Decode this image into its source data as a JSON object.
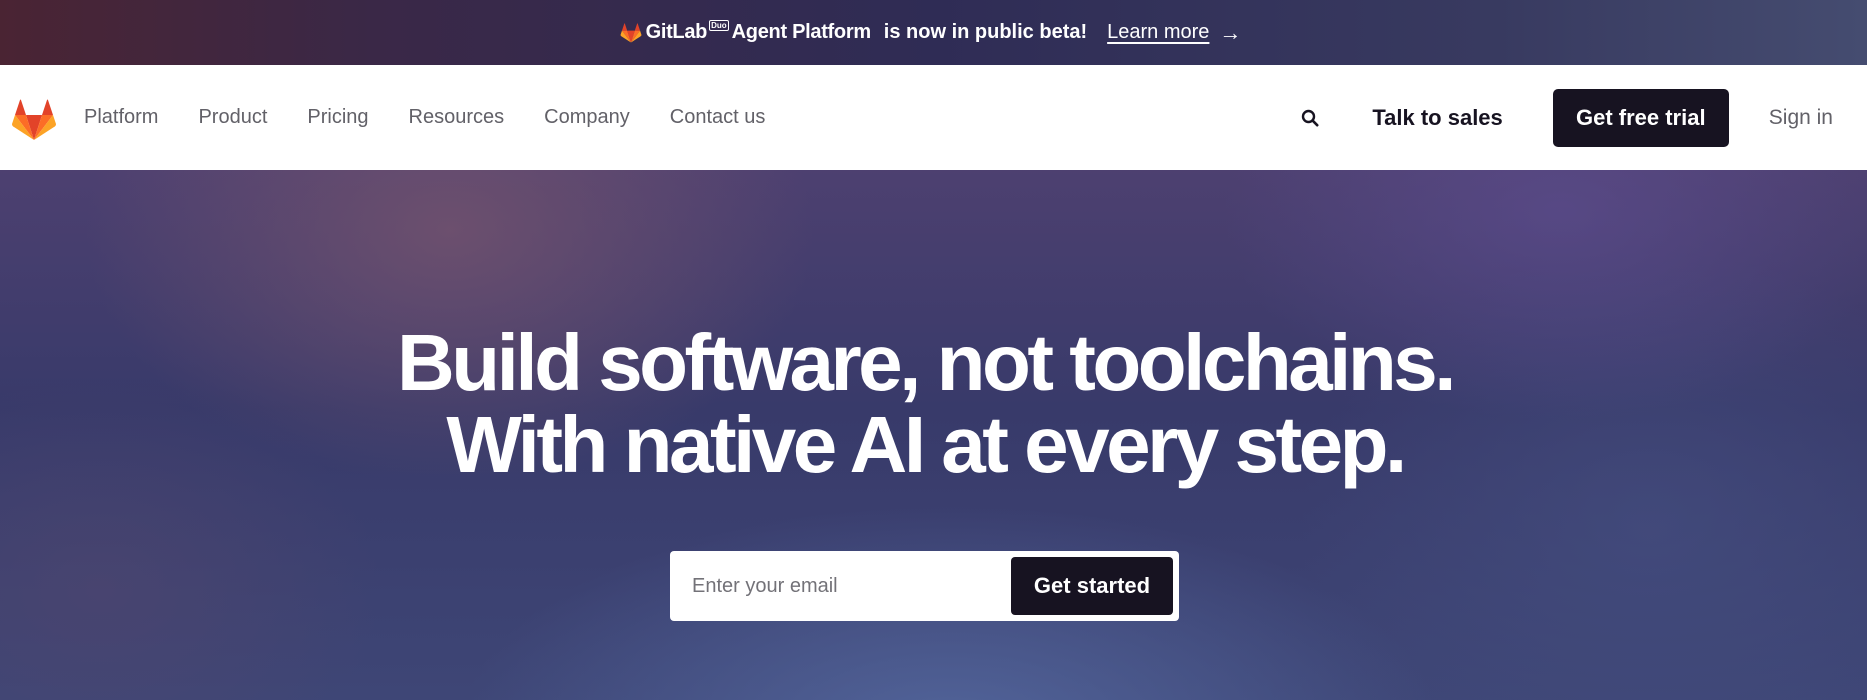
{
  "banner": {
    "brand": "GitLab",
    "brand_badge": "Duo",
    "product": "Agent Platform",
    "message": "is now in public beta!",
    "link_label": "Learn more",
    "arrow": "→",
    "logo_icon": "gitlab-tanuki-icon"
  },
  "nav": {
    "logo_icon": "gitlab-tanuki-icon",
    "links": [
      "Platform",
      "Product",
      "Pricing",
      "Resources",
      "Company",
      "Contact us"
    ],
    "search_icon": "search-icon",
    "talk_to_sales": "Talk to sales",
    "free_trial": "Get free trial",
    "sign_in": "Sign in"
  },
  "hero": {
    "title_line1": "Build software, not toolchains.",
    "title_line2": "With native AI at every step.",
    "email_placeholder": "Enter your email",
    "cta_label": "Get started"
  },
  "colors": {
    "brand_orange": "#fc6d26",
    "brand_red": "#e24329",
    "brand_light_orange": "#fca326",
    "dark": "#171321",
    "nav_text": "#626168"
  }
}
